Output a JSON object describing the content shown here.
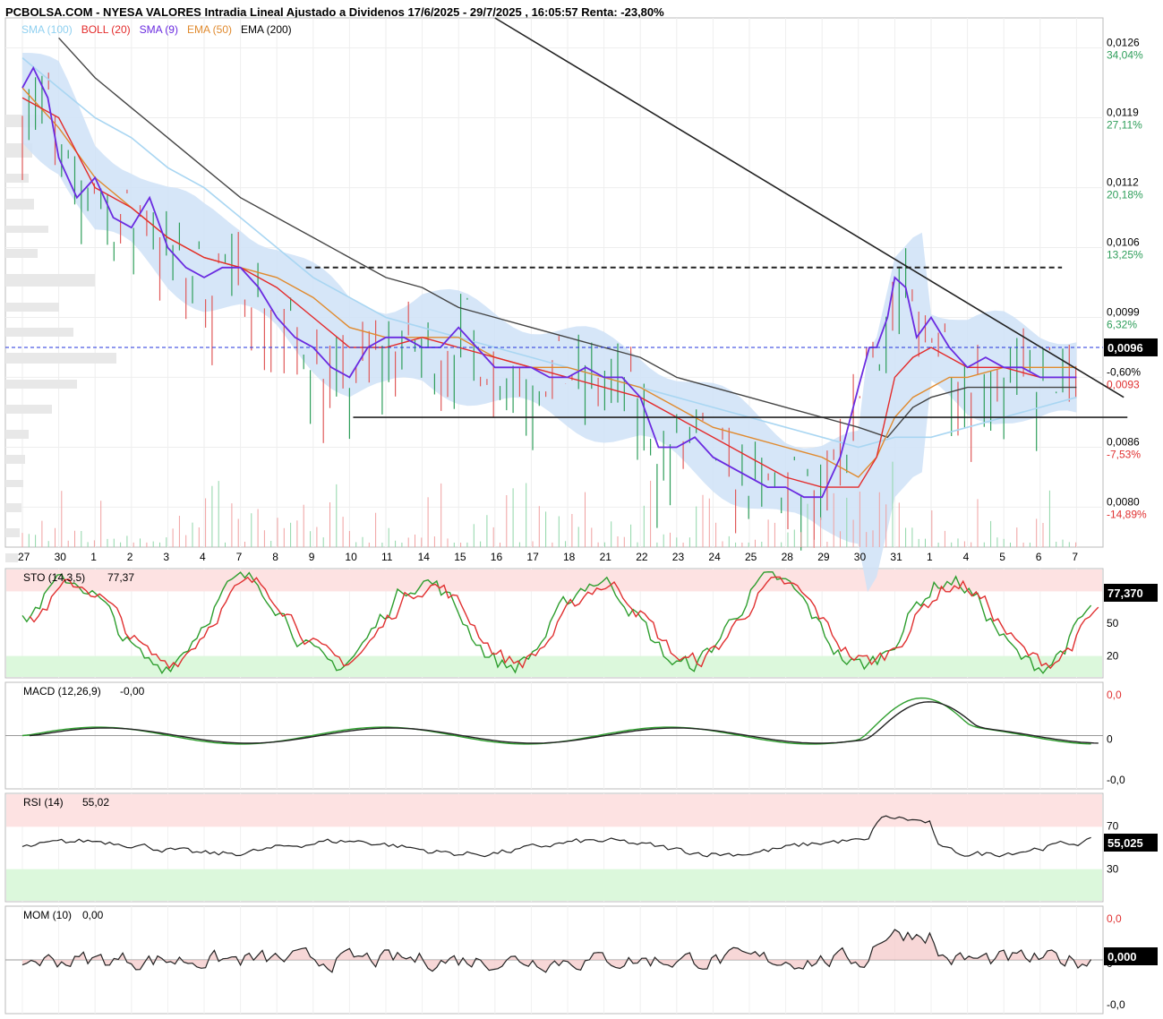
{
  "header": {
    "title": "PCBOLSA.COM - NYESA VALORES Intradia Lineal Ajustado a Dividenos 17/6/2025 - 29/7/2025 , 16:05:57 Renta: -23,80%"
  },
  "legend": [
    {
      "label": "SMA (100)",
      "color": "#8fd0f0"
    },
    {
      "label": "BOLL (20)",
      "color": "#e32b2b"
    },
    {
      "label": "SMA (9)",
      "color": "#6a2be0"
    },
    {
      "label": "EMA (50)",
      "color": "#e08a2e"
    },
    {
      "label": "EMA (200)",
      "color": "#333333"
    }
  ],
  "colors": {
    "up": "#2e9e5a",
    "down": "#e05a5a",
    "boll_fill": "#cfe2f7",
    "sma100": "#a9d6f2",
    "boll": "#e32b2b",
    "sma9": "#6a2be0",
    "ema50": "#e08a2e",
    "ema200": "#444444",
    "sto_k": "#2e9e2e",
    "sto_d": "#e03030",
    "overbought_bg": "#fde2e2",
    "oversold_bg": "#dcf8dc"
  },
  "chart_data": [
    {
      "type": "line",
      "title": "NYESA VALORES Intradia",
      "x_ticks": [
        "27",
        "30",
        "1",
        "2",
        "3",
        "4",
        "7",
        "8",
        "9",
        "10",
        "11",
        "14",
        "15",
        "16",
        "17",
        "18",
        "21",
        "22",
        "23",
        "24",
        "25",
        "28",
        "29",
        "30",
        "31",
        "1",
        "4",
        "5",
        "6",
        "7"
      ],
      "ylim": [
        0.0076,
        0.0129
      ],
      "y_ticks": [
        {
          "value": 0.0126,
          "label": "0,0126",
          "pct": "34,04%"
        },
        {
          "value": 0.0119,
          "label": "0,0119",
          "pct": "27,11%"
        },
        {
          "value": 0.0112,
          "label": "0,0112",
          "pct": "20,18%"
        },
        {
          "value": 0.0106,
          "label": "0,0106",
          "pct": "13,25%"
        },
        {
          "value": 0.0099,
          "label": "0,0099",
          "pct": "6,32%"
        },
        {
          "value": 0.0093,
          "label": "-0,60%",
          "pct": "0,0093"
        },
        {
          "value": 0.0086,
          "label": "0,0086",
          "pct": "-7,53%"
        },
        {
          "value": 0.008,
          "label": "0,0080",
          "pct": "-14,89%"
        }
      ],
      "last_price": {
        "value": 0.0096,
        "label": "0,0096"
      },
      "horizontal_levels": [
        {
          "value": 0.0104,
          "style": "dashed",
          "from_day": 7.8,
          "to_day": 28.6
        },
        {
          "value": 0.0096,
          "style": "dashed-blue"
        }
      ],
      "trendlines": [
        {
          "from": [
            13.0,
            0.0129
          ],
          "to": [
            30.3,
            0.0091
          ]
        },
        {
          "from": [
            9.1,
            0.0089
          ],
          "to": [
            30.4,
            0.0089
          ]
        }
      ],
      "series": [
        {
          "name": "SMA (9)",
          "x": [
            0,
            0.3,
            0.7,
            1,
            1.5,
            2,
            2.5,
            3,
            3.5,
            4,
            4.5,
            5,
            5.5,
            6,
            6.5,
            7,
            7.5,
            8,
            8.5,
            9,
            9.5,
            10,
            10.5,
            11,
            11.5,
            12,
            12.5,
            13,
            13.5,
            14,
            14.5,
            15,
            15.5,
            16,
            16.5,
            17,
            17.5,
            18,
            18.5,
            19,
            19.5,
            20,
            20.5,
            21,
            21.5,
            22,
            22.5,
            23,
            23.3,
            23.5,
            23.8,
            24,
            24.3,
            24.6,
            25,
            25.5,
            26,
            26.5,
            27,
            27.5,
            28,
            28.5,
            29
          ],
          "values": [
            0.0122,
            0.0124,
            0.0121,
            0.0115,
            0.0111,
            0.0113,
            0.0109,
            0.0108,
            0.0111,
            0.0106,
            0.0104,
            0.0103,
            0.0104,
            0.0104,
            0.0102,
            0.0099,
            0.0097,
            0.0096,
            0.0094,
            0.0093,
            0.0096,
            0.0097,
            0.0097,
            0.0096,
            0.0096,
            0.0098,
            0.0096,
            0.0094,
            0.0094,
            0.0094,
            0.0093,
            0.0093,
            0.0094,
            0.0093,
            0.0093,
            0.0091,
            0.0086,
            0.0086,
            0.0087,
            0.0085,
            0.0084,
            0.0083,
            0.0082,
            0.0082,
            0.0081,
            0.0081,
            0.0085,
            0.0092,
            0.0096,
            0.0096,
            0.0099,
            0.0103,
            0.0102,
            0.0097,
            0.0099,
            0.0096,
            0.0094,
            0.0095,
            0.0094,
            0.0094,
            0.0093,
            0.0093,
            0.0093
          ]
        },
        {
          "name": "BOLL (20)",
          "x": [
            0,
            1,
            2,
            3,
            4,
            5,
            6,
            7,
            8,
            9,
            10,
            11,
            12,
            13,
            14,
            15,
            16,
            17,
            18,
            19,
            20,
            21,
            22,
            23,
            23.5,
            24,
            24.5,
            25,
            25.5,
            26,
            27,
            28,
            29
          ],
          "values": [
            0.0121,
            0.0119,
            0.0112,
            0.011,
            0.0107,
            0.0105,
            0.0104,
            0.0102,
            0.0099,
            0.0096,
            0.0096,
            0.0097,
            0.0096,
            0.0095,
            0.0094,
            0.0093,
            0.0092,
            0.0091,
            0.0089,
            0.0087,
            0.0085,
            0.0083,
            0.0082,
            0.0082,
            0.0085,
            0.0093,
            0.0095,
            0.0096,
            0.0095,
            0.0094,
            0.0094,
            0.0093,
            0.0093
          ]
        },
        {
          "name": "EMA (50)",
          "x": [
            0,
            1,
            2,
            3,
            4,
            5,
            6,
            7,
            8,
            9,
            10,
            11,
            12,
            13,
            14,
            15,
            16,
            17,
            18,
            19,
            20,
            21,
            22,
            23,
            23.5,
            24,
            24.5,
            25,
            25.5,
            26,
            27,
            28,
            29
          ],
          "values": [
            0.0122,
            0.0118,
            0.0113,
            0.011,
            0.0107,
            0.0105,
            0.0104,
            0.0103,
            0.0101,
            0.0098,
            0.0097,
            0.0097,
            0.0097,
            0.0095,
            0.0094,
            0.0094,
            0.0093,
            0.0092,
            0.009,
            0.0088,
            0.0087,
            0.0086,
            0.0085,
            0.0083,
            0.0085,
            0.0089,
            0.0091,
            0.0092,
            0.0093,
            0.0093,
            0.0094,
            0.0094,
            0.0094
          ]
        },
        {
          "name": "SMA (100)",
          "x": [
            0,
            1,
            2,
            3,
            4,
            5,
            6,
            7,
            8,
            9,
            10,
            11,
            12,
            13,
            14,
            15,
            16,
            17,
            18,
            19,
            20,
            21,
            22,
            23,
            24,
            25,
            26,
            27,
            28,
            29
          ],
          "values": [
            0.0125,
            0.0122,
            0.0119,
            0.0117,
            0.0114,
            0.0112,
            0.0109,
            0.0106,
            0.0103,
            0.0101,
            0.0099,
            0.0098,
            0.0097,
            0.0096,
            0.0095,
            0.0094,
            0.0093,
            0.0092,
            0.0091,
            0.009,
            0.0089,
            0.0088,
            0.0087,
            0.0086,
            0.0087,
            0.0087,
            0.0088,
            0.0089,
            0.009,
            0.0091
          ]
        },
        {
          "name": "EMA (200)",
          "x": [
            1,
            2,
            3,
            4,
            5,
            6,
            7,
            8,
            9,
            10,
            11,
            12,
            13,
            14,
            15,
            16,
            17,
            18,
            19,
            20,
            21,
            22,
            23,
            23.8,
            24.5,
            25,
            26,
            27,
            28,
            29
          ],
          "values": [
            0.0127,
            0.0123,
            0.012,
            0.0117,
            0.0114,
            0.0111,
            0.0109,
            0.0107,
            0.0105,
            0.0103,
            0.0102,
            0.01,
            0.0099,
            0.0098,
            0.0097,
            0.0096,
            0.0095,
            0.0093,
            0.0092,
            0.0091,
            0.009,
            0.0089,
            0.0088,
            0.0087,
            0.009,
            0.0091,
            0.0092,
            0.0092,
            0.0092,
            0.0092
          ]
        }
      ]
    },
    {
      "type": "line",
      "title": "STO (14,3,5)",
      "value_label": "77,37",
      "last_value": "77,370",
      "ylim": [
        0,
        100
      ],
      "y_ticks": [
        {
          "value": 50,
          "label": "50"
        },
        {
          "value": 20,
          "label": "20"
        }
      ],
      "bands": {
        "overbought": 80,
        "oversold": 20
      }
    },
    {
      "type": "line",
      "title": "MACD (12,26,9)",
      "value_label": "-0,00",
      "y_ticks": [
        {
          "label": "0,0"
        },
        {
          "label": "0"
        },
        {
          "label": "-0,0"
        }
      ]
    },
    {
      "type": "line",
      "title": "RSI (14)",
      "value_label": "55,02",
      "last_value": "55,025",
      "ylim": [
        0,
        100
      ],
      "y_ticks": [
        {
          "value": 70,
          "label": "70"
        },
        {
          "value": 30,
          "label": "30"
        }
      ],
      "bands": {
        "overbought": 70,
        "oversold": 30
      }
    },
    {
      "type": "area",
      "title": "MOM (10)",
      "value_label": "0,00",
      "last_value": "0,000",
      "y_ticks": [
        {
          "label": "0,0"
        },
        {
          "label": "0"
        },
        {
          "label": "-0,0"
        }
      ]
    }
  ]
}
